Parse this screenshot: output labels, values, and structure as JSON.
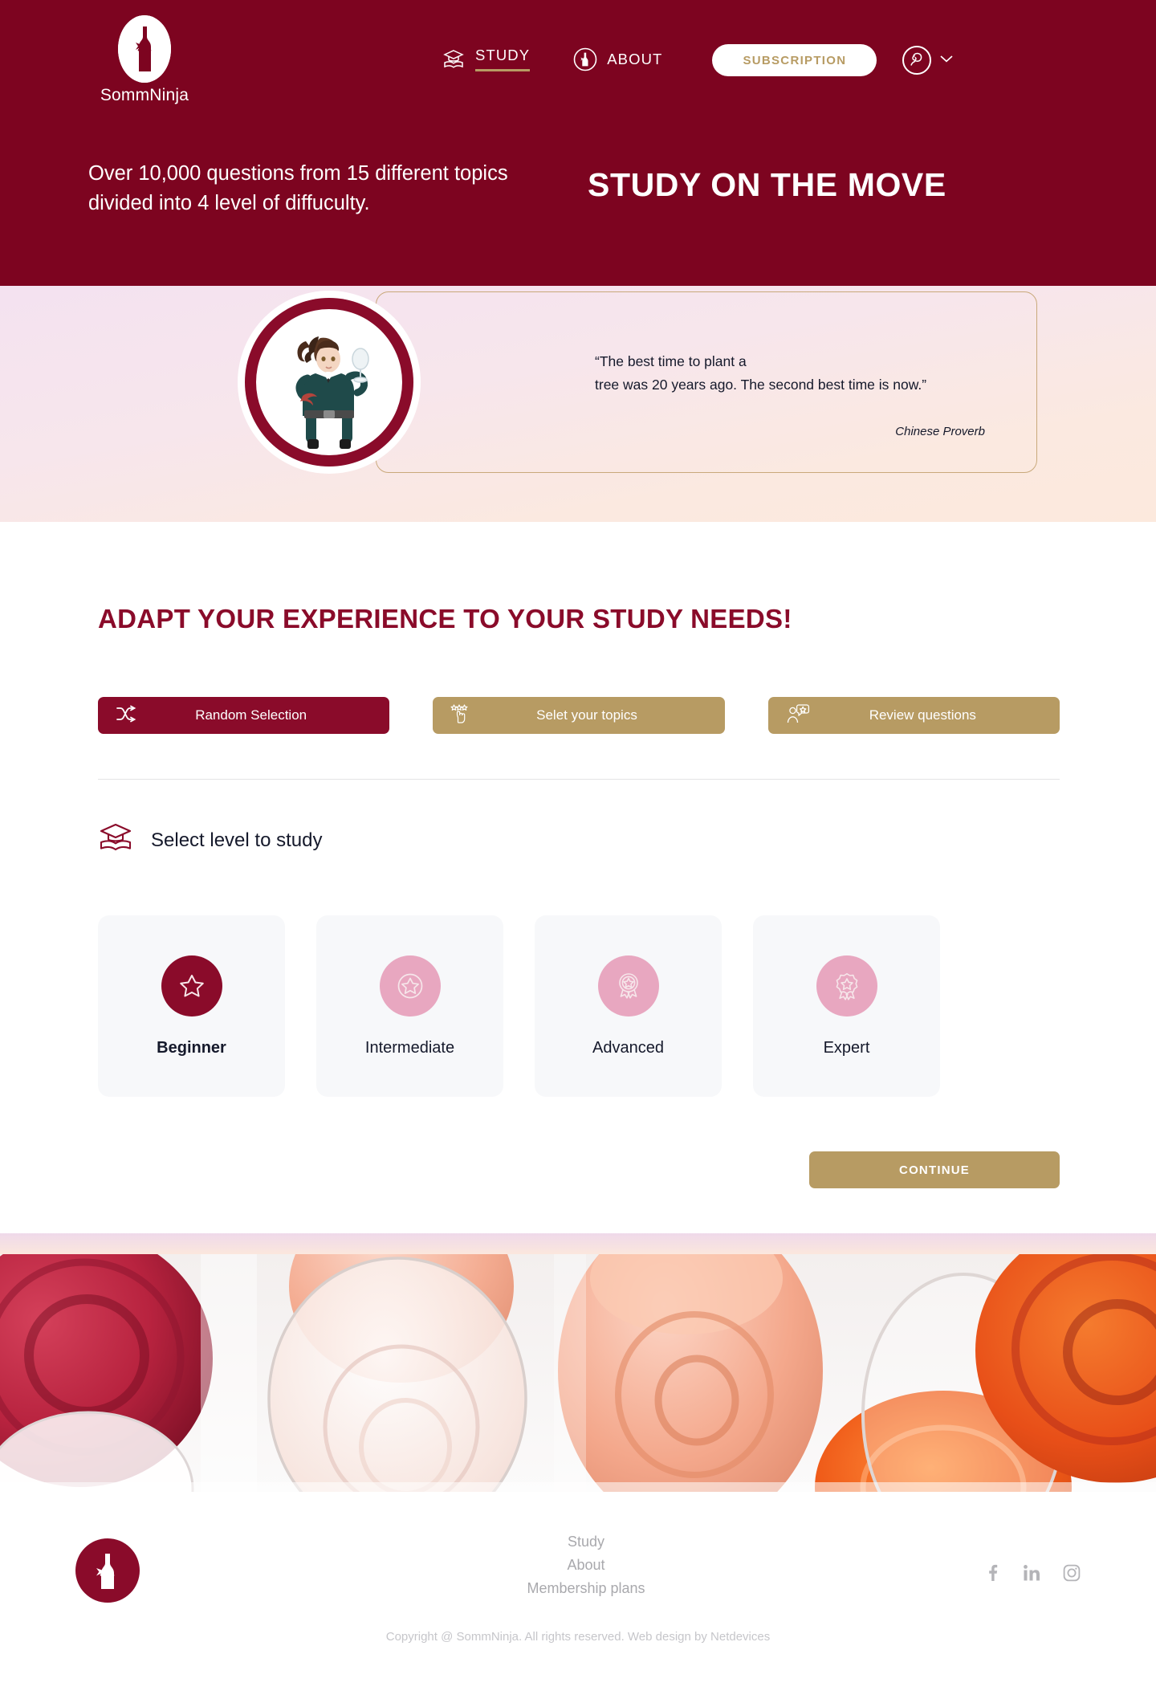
{
  "brand": {
    "name": "SommNinja",
    "logo_icon": "wine-bottle-icon"
  },
  "header": {
    "nav": [
      {
        "label": "STUDY",
        "icon": "graduation-cap-book-icon",
        "active": true
      },
      {
        "label": "ABOUT",
        "icon": "wine-bottle-circle-icon",
        "active": false
      }
    ],
    "subscribe_label": "SUBSCRIPTION",
    "account_icon": "user-avatar-icon",
    "chevron_icon": "chevron-down-icon",
    "hero_sub": "Over 10,000 questions from 15 different topics divided into 4 level of diffuculty.",
    "hero_title": "STUDY ON THE MOVE",
    "colors": {
      "background": "#7d0420",
      "accent_gold": "#b79b63"
    }
  },
  "quote": {
    "avatar_icon": "ninja-sommelier-avatar",
    "line1": "“The best time to plant a",
    "line2": "tree was 20 years ago. The second best time is now.”",
    "author": "Chinese Proverb"
  },
  "main": {
    "section_title": "ADAPT YOUR EXPERIENCE TO YOUR STUDY NEEDS!",
    "modes": [
      {
        "label": "Random Selection",
        "icon": "shuffle-icon",
        "style": "primary"
      },
      {
        "label": "Selet your topics",
        "icon": "hand-pointer-stars-icon",
        "style": "gold"
      },
      {
        "label": "Review questions",
        "icon": "user-speech-star-icon",
        "style": "gold"
      }
    ],
    "level_head": {
      "label": "Select level to study",
      "icon": "graduation-cap-book-icon"
    },
    "levels": [
      {
        "label": "Beginner",
        "icon": "star-icon",
        "selected": true
      },
      {
        "label": "Intermediate",
        "icon": "star-in-circle-icon",
        "selected": false
      },
      {
        "label": "Advanced",
        "icon": "medal-ribbon-star-icon",
        "selected": false
      },
      {
        "label": "Expert",
        "icon": "badge-rosette-star-icon",
        "selected": false
      }
    ],
    "continue_label": "CONTINUE"
  },
  "photo": {
    "alt": "rose-wine-glasses-photo"
  },
  "footer": {
    "logo_icon": "wine-bottle-icon",
    "links": [
      "Study",
      "About",
      "Membership plans"
    ],
    "socials": [
      {
        "name": "facebook-icon"
      },
      {
        "name": "linkedin-icon"
      },
      {
        "name": "instagram-icon"
      }
    ],
    "copyright": "Copyright @ SommNinja. All rights reserved. Web design by Netdevices"
  }
}
